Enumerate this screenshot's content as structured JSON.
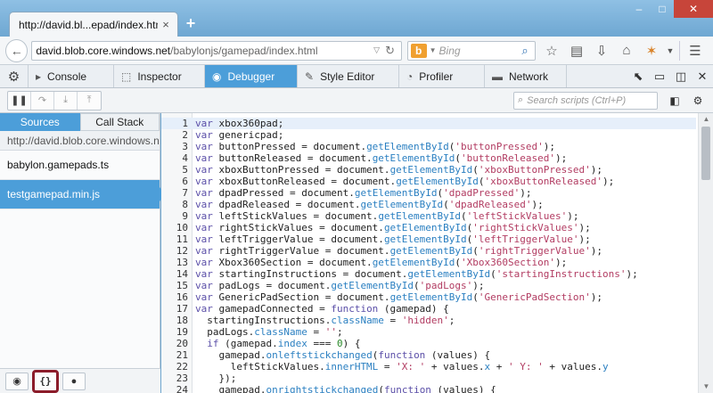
{
  "window": {
    "tab_title": "http://david.bl...epad/index.html",
    "tab_close": "×",
    "new_tab": "+",
    "minimize": "–",
    "maximize": "□",
    "close": "✕"
  },
  "navbar": {
    "url_host": "david.blob.core.windows.net",
    "url_path": "/babylonjs/gamepad/index.html",
    "search_engine_letter": "b",
    "search_placeholder": "Bing"
  },
  "devtools": {
    "tabs": [
      {
        "label": "Console",
        "icon": "console-icon",
        "glyph": "▸"
      },
      {
        "label": "Inspector",
        "icon": "inspector-icon",
        "glyph": "⬚"
      },
      {
        "label": "Debugger",
        "icon": "debugger-icon",
        "glyph": "◉"
      },
      {
        "label": "Style Editor",
        "icon": "style-editor-icon",
        "glyph": "✎"
      },
      {
        "label": "Profiler",
        "icon": "profiler-icon",
        "glyph": "◔"
      },
      {
        "label": "Network",
        "icon": "network-icon",
        "glyph": "▬"
      }
    ],
    "active_tab": "Debugger",
    "accent": "#4c9ed9"
  },
  "debugger": {
    "script_search_placeholder": "Search scripts (Ctrl+P)"
  },
  "sources": {
    "tabs": [
      "Sources",
      "Call Stack"
    ],
    "host": "http://david.blob.core.windows.net",
    "items": [
      "babylon.gamepads.ts",
      "testgamepad.min.js"
    ],
    "selected": "testgamepad.min.js",
    "footer_pretty_print": "{}"
  },
  "code": {
    "lines": [
      [
        [
          "kw",
          "var"
        ],
        [
          "id",
          " xbox360pad;"
        ]
      ],
      [
        [
          "kw",
          "var"
        ],
        [
          "id",
          " genericpad;"
        ]
      ],
      [
        [
          "kw",
          "var"
        ],
        [
          "id",
          " buttonPressed = document."
        ],
        [
          "prop",
          "getElementById"
        ],
        [
          "id",
          "("
        ],
        [
          "str",
          "'buttonPressed'"
        ],
        [
          "id",
          ");"
        ]
      ],
      [
        [
          "kw",
          "var"
        ],
        [
          "id",
          " buttonReleased = document."
        ],
        [
          "prop",
          "getElementById"
        ],
        [
          "id",
          "("
        ],
        [
          "str",
          "'buttonReleased'"
        ],
        [
          "id",
          ");"
        ]
      ],
      [
        [
          "kw",
          "var"
        ],
        [
          "id",
          " xboxButtonPressed = document."
        ],
        [
          "prop",
          "getElementById"
        ],
        [
          "id",
          "("
        ],
        [
          "str",
          "'xboxButtonPressed'"
        ],
        [
          "id",
          ");"
        ]
      ],
      [
        [
          "kw",
          "var"
        ],
        [
          "id",
          " xboxButtonReleased = document."
        ],
        [
          "prop",
          "getElementById"
        ],
        [
          "id",
          "("
        ],
        [
          "str",
          "'xboxButtonReleased'"
        ],
        [
          "id",
          ");"
        ]
      ],
      [
        [
          "kw",
          "var"
        ],
        [
          "id",
          " dpadPressed = document."
        ],
        [
          "prop",
          "getElementById"
        ],
        [
          "id",
          "("
        ],
        [
          "str",
          "'dpadPressed'"
        ],
        [
          "id",
          ");"
        ]
      ],
      [
        [
          "kw",
          "var"
        ],
        [
          "id",
          " dpadReleased = document."
        ],
        [
          "prop",
          "getElementById"
        ],
        [
          "id",
          "("
        ],
        [
          "str",
          "'dpadReleased'"
        ],
        [
          "id",
          ");"
        ]
      ],
      [
        [
          "kw",
          "var"
        ],
        [
          "id",
          " leftStickValues = document."
        ],
        [
          "prop",
          "getElementById"
        ],
        [
          "id",
          "("
        ],
        [
          "str",
          "'leftStickValues'"
        ],
        [
          "id",
          ");"
        ]
      ],
      [
        [
          "kw",
          "var"
        ],
        [
          "id",
          " rightStickValues = document."
        ],
        [
          "prop",
          "getElementById"
        ],
        [
          "id",
          "("
        ],
        [
          "str",
          "'rightStickValues'"
        ],
        [
          "id",
          ");"
        ]
      ],
      [
        [
          "kw",
          "var"
        ],
        [
          "id",
          " leftTriggerValue = document."
        ],
        [
          "prop",
          "getElementById"
        ],
        [
          "id",
          "("
        ],
        [
          "str",
          "'leftTriggerValue'"
        ],
        [
          "id",
          ");"
        ]
      ],
      [
        [
          "kw",
          "var"
        ],
        [
          "id",
          " rightTriggerValue = document."
        ],
        [
          "prop",
          "getElementById"
        ],
        [
          "id",
          "("
        ],
        [
          "str",
          "'rightTriggerValue'"
        ],
        [
          "id",
          ");"
        ]
      ],
      [
        [
          "kw",
          "var"
        ],
        [
          "id",
          " Xbox360Section = document."
        ],
        [
          "prop",
          "getElementById"
        ],
        [
          "id",
          "("
        ],
        [
          "str",
          "'Xbox360Section'"
        ],
        [
          "id",
          ");"
        ]
      ],
      [
        [
          "kw",
          "var"
        ],
        [
          "id",
          " startingInstructions = document."
        ],
        [
          "prop",
          "getElementById"
        ],
        [
          "id",
          "("
        ],
        [
          "str",
          "'startingInstructions'"
        ],
        [
          "id",
          ");"
        ]
      ],
      [
        [
          "kw",
          "var"
        ],
        [
          "id",
          " padLogs = document."
        ],
        [
          "prop",
          "getElementById"
        ],
        [
          "id",
          "("
        ],
        [
          "str",
          "'padLogs'"
        ],
        [
          "id",
          ");"
        ]
      ],
      [
        [
          "kw",
          "var"
        ],
        [
          "id",
          " GenericPadSection = document."
        ],
        [
          "prop",
          "getElementById"
        ],
        [
          "id",
          "("
        ],
        [
          "str",
          "'GenericPadSection'"
        ],
        [
          "id",
          ");"
        ]
      ],
      [
        [
          "kw",
          "var"
        ],
        [
          "id",
          " gamepadConnected = "
        ],
        [
          "kw",
          "function"
        ],
        [
          "id",
          " (gamepad) {"
        ]
      ],
      [
        [
          "id",
          "  startingInstructions."
        ],
        [
          "prop",
          "className"
        ],
        [
          "id",
          " = "
        ],
        [
          "str",
          "'hidden'"
        ],
        [
          "id",
          ";"
        ]
      ],
      [
        [
          "id",
          "  padLogs."
        ],
        [
          "prop",
          "className"
        ],
        [
          "id",
          " = "
        ],
        [
          "str",
          "''"
        ],
        [
          "id",
          ";"
        ]
      ],
      [
        [
          "kw",
          "  if"
        ],
        [
          "id",
          " (gamepad."
        ],
        [
          "prop",
          "index"
        ],
        [
          "id",
          " === "
        ],
        [
          "num",
          "0"
        ],
        [
          "id",
          ") {"
        ]
      ],
      [
        [
          "id",
          "    gamepad."
        ],
        [
          "prop",
          "onleftstickchanged"
        ],
        [
          "id",
          "("
        ],
        [
          "kw",
          "function"
        ],
        [
          "id",
          " (values) {"
        ]
      ],
      [
        [
          "id",
          "      leftStickValues."
        ],
        [
          "prop",
          "innerHTML"
        ],
        [
          "id",
          " = "
        ],
        [
          "str",
          "'X: '"
        ],
        [
          "id",
          " + values."
        ],
        [
          "prop",
          "x"
        ],
        [
          "id",
          " + "
        ],
        [
          "str",
          "' Y: '"
        ],
        [
          "id",
          " + values."
        ],
        [
          "prop",
          "y"
        ]
      ],
      [
        [
          "id",
          "    });"
        ]
      ],
      [
        [
          "id",
          "    gamepad."
        ],
        [
          "prop",
          "onrightstickchanged"
        ],
        [
          "id",
          "("
        ],
        [
          "kw",
          "function"
        ],
        [
          "id",
          " (values) {"
        ]
      ]
    ]
  }
}
